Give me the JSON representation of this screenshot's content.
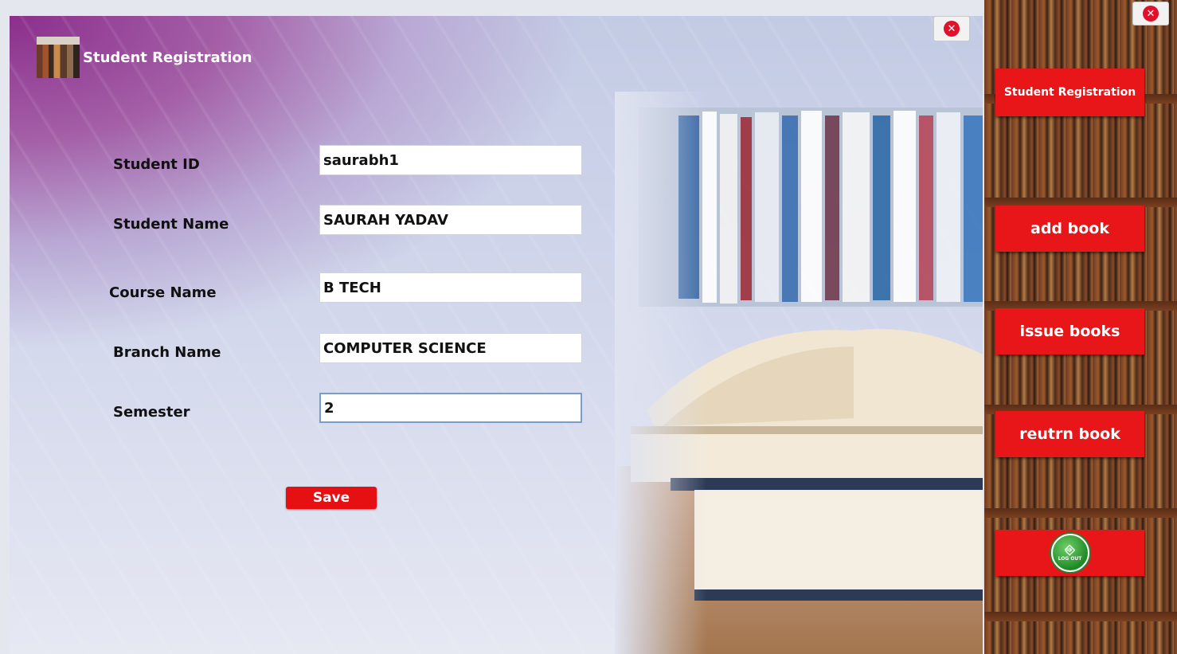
{
  "window": {
    "close_symbol": "✕",
    "icon": "close-icon"
  },
  "header": {
    "title": "Student Registration",
    "logo_icon": "library-logo"
  },
  "form": {
    "fields": [
      {
        "label": "Student ID",
        "value": "saurabh1"
      },
      {
        "label": "Student Name",
        "value": "SAURAH YADAV"
      },
      {
        "label": "Course Name",
        "value": "B TECH"
      },
      {
        "label": "Branch Name",
        "value": "COMPUTER SCIENCE"
      },
      {
        "label": "Semester",
        "value": "2"
      }
    ],
    "save_label": "Save"
  },
  "sidebar": {
    "close_symbol": "✕",
    "buttons": [
      {
        "label": "Student Registration"
      },
      {
        "label": "add book"
      },
      {
        "label": "issue books"
      },
      {
        "label": "reutrn book"
      }
    ],
    "logout": {
      "icon": "logout-icon",
      "symbol": "⎆",
      "text": "LOG OUT"
    }
  },
  "colors": {
    "accent": "#e81618",
    "close": "#e0112a",
    "logout_green": "#1e8a25"
  }
}
